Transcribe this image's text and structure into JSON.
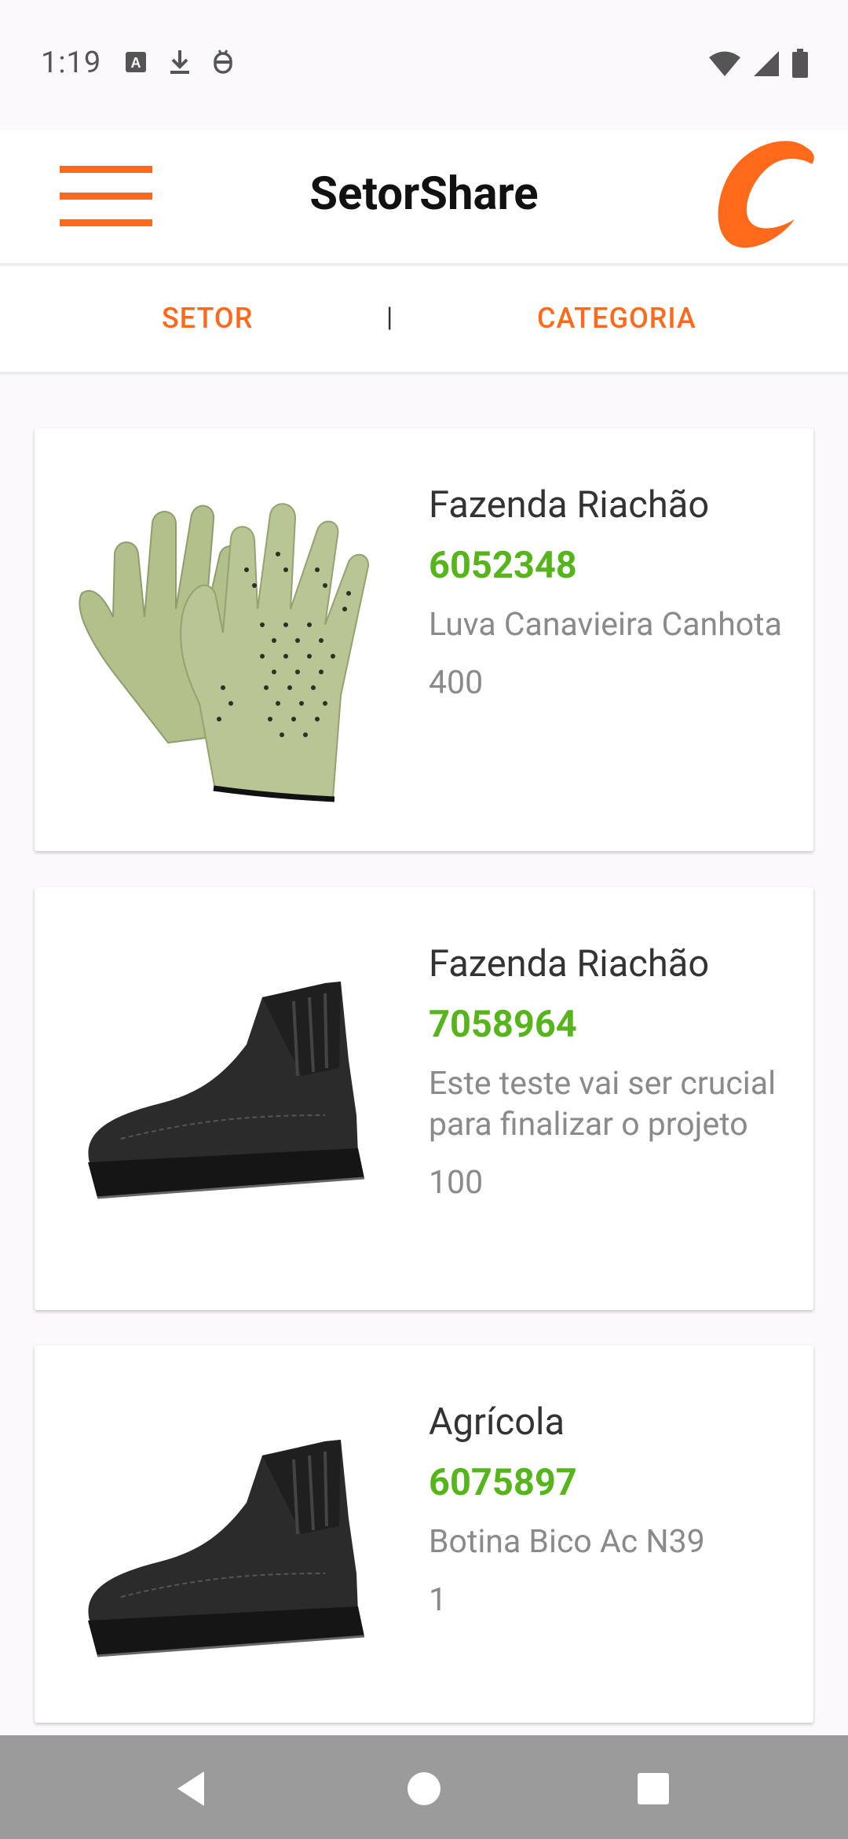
{
  "status_bar": {
    "time": "1:19",
    "icons_left": [
      "translate-icon",
      "download-icon",
      "robot-icon"
    ],
    "icons_right": [
      "wifi-icon",
      "signal-icon",
      "battery-icon"
    ]
  },
  "app_bar": {
    "title": "SetorShare",
    "menu_icon": "hamburger-menu-icon",
    "logo": "brand-logo",
    "accent_color": "#ff6a1a"
  },
  "tabs": {
    "setor": "SETOR",
    "separator": "|",
    "categoria": "CATEGORIA"
  },
  "items": [
    {
      "farm": "Fazenda Riachão",
      "code": "6052348",
      "description": "Luva Canavieira Canhota",
      "quantity": "400",
      "image": "glove-image"
    },
    {
      "farm": "Fazenda Riachão",
      "code": "7058964",
      "description": "Este teste vai ser crucial para finalizar o projeto",
      "quantity": "100",
      "image": "boot-image"
    },
    {
      "farm": "Agrícola",
      "code": "6075897",
      "description": "Botina Bico Ac N39",
      "quantity": "1",
      "image": "boot-image"
    }
  ],
  "colors": {
    "code_green": "#56b51a",
    "orange": "#ff6a1a"
  },
  "nav_bar": {
    "buttons": [
      "back-icon",
      "home-icon",
      "recents-icon"
    ]
  }
}
